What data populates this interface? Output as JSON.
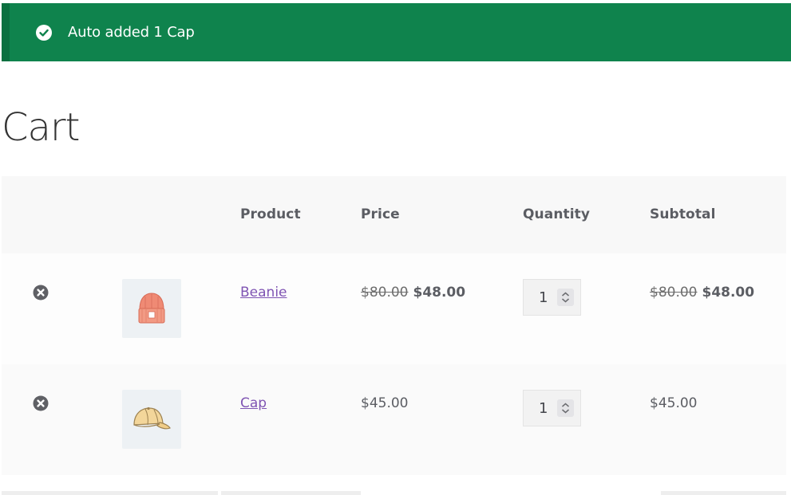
{
  "notice": {
    "message": "Auto added 1 Cap",
    "icon": "check-circle-icon",
    "color": "#0f834d"
  },
  "page": {
    "title": "Cart"
  },
  "cart": {
    "headers": {
      "product": "Product",
      "price": "Price",
      "quantity": "Quantity",
      "subtotal": "Subtotal"
    },
    "items": [
      {
        "name": "Beanie",
        "price_old": "$80.00",
        "price": "$48.00",
        "quantity": "1",
        "subtotal_old": "$80.00",
        "subtotal": "$48.00",
        "thumb_icon": "beanie-icon"
      },
      {
        "name": "Cap",
        "price": "$45.00",
        "quantity": "1",
        "subtotal": "$45.00",
        "thumb_icon": "cap-icon"
      }
    ]
  },
  "colors": {
    "link": "#7f54b3",
    "notice_bg": "#0f834d"
  }
}
